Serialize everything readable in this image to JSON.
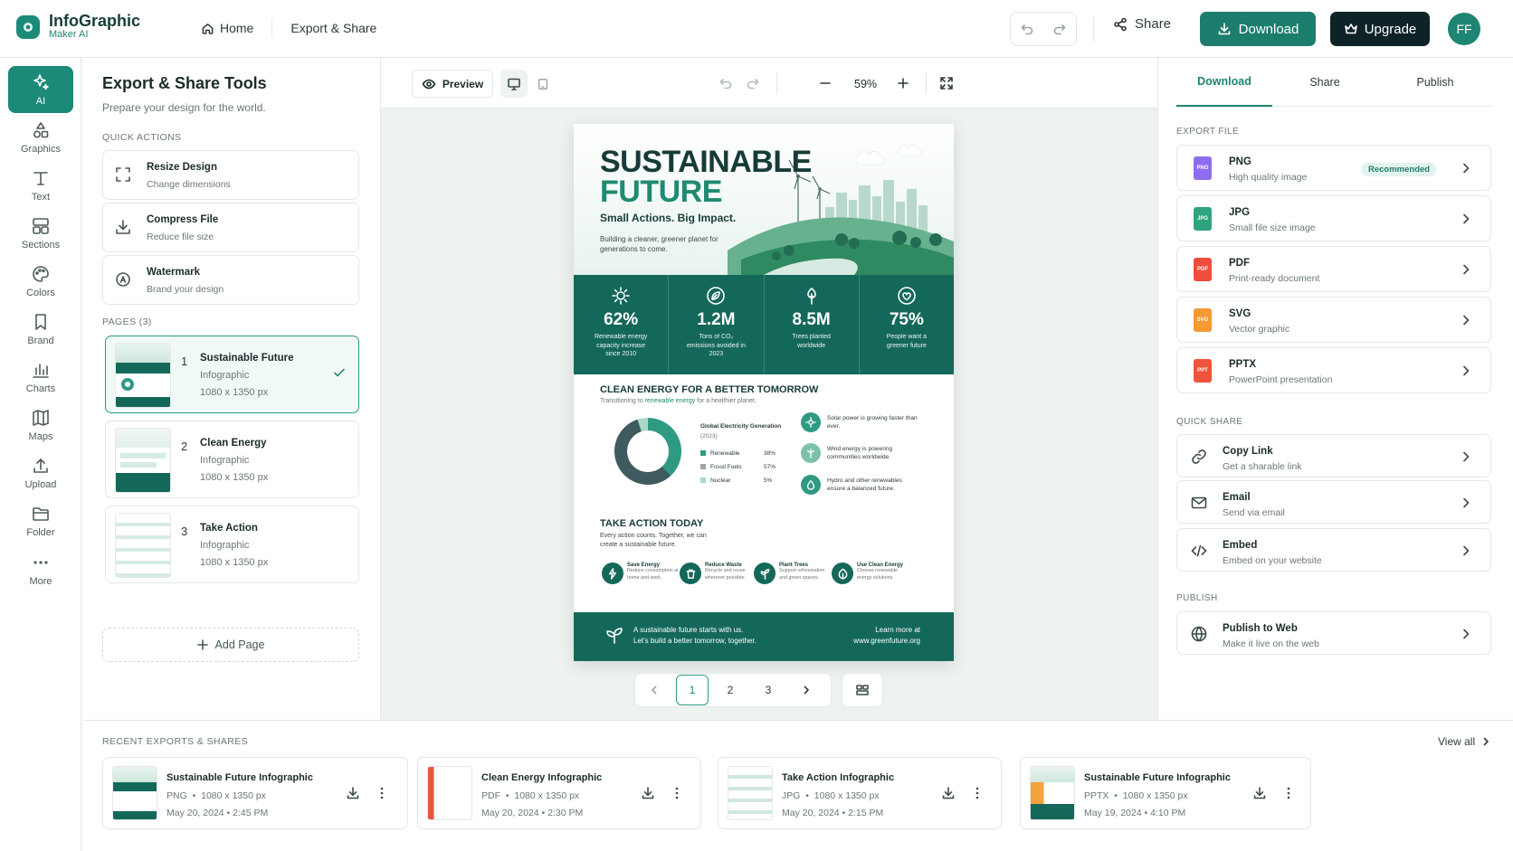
{
  "app": {
    "name": "InfoGraphic",
    "subtitle": "Maker AI",
    "avatar": "FF"
  },
  "nav": {
    "home": "Home",
    "current": "Export & Share"
  },
  "topbar": {
    "share": "Share",
    "download": "Download",
    "upgrade": "Upgrade"
  },
  "rail": [
    {
      "label": "AI",
      "icon": "sparkle-icon",
      "active": true
    },
    {
      "label": "Graphics",
      "icon": "shapes-icon"
    },
    {
      "label": "Text",
      "icon": "text-icon"
    },
    {
      "label": "Sections",
      "icon": "sections-icon"
    },
    {
      "label": "Colors",
      "icon": "palette-icon"
    },
    {
      "label": "Brand",
      "icon": "bookmark-icon"
    },
    {
      "label": "Charts",
      "icon": "bar-chart-icon"
    },
    {
      "label": "Maps",
      "icon": "map-icon"
    },
    {
      "label": "Upload",
      "icon": "upload-icon"
    },
    {
      "label": "Folder",
      "icon": "folder-icon"
    },
    {
      "label": "More",
      "icon": "more-icon"
    }
  ],
  "left_panel": {
    "title": "Export & Share Tools",
    "subtitle": "Prepare your design for the world.",
    "quick_actions_label": "QUICK ACTIONS",
    "quick_actions": [
      {
        "title": "Resize Design",
        "sub": "Change dimensions",
        "icon": "resize-icon"
      },
      {
        "title": "Compress File",
        "sub": "Reduce file size",
        "icon": "compress-icon"
      },
      {
        "title": "Watermark",
        "sub": "Brand your design",
        "icon": "watermark-icon"
      }
    ],
    "pages_label": "PAGES",
    "pages_count": "(3)",
    "pages": [
      {
        "num": "1",
        "title": "Sustainable Future",
        "type": "Infographic",
        "size": "1080 x 1350 px",
        "selected": true
      },
      {
        "num": "2",
        "title": "Clean Energy",
        "type": "Infographic",
        "size": "1080 x 1350 px"
      },
      {
        "num": "3",
        "title": "Take Action",
        "type": "Infographic",
        "size": "1080 x 1350 px"
      }
    ],
    "add_page": "Add Page"
  },
  "canvas": {
    "preview": "Preview",
    "zoom": "59%",
    "pager": [
      "1",
      "2",
      "3"
    ],
    "current_page": "1"
  },
  "poster": {
    "title_1": "SUSTAINABLE",
    "title_2": "FUTURE",
    "tagline": "Small Actions. Big Impact.",
    "desc": "Building a cleaner, greener planet for generations to come.",
    "stats": [
      {
        "value": "62%",
        "label": "Renewable energy capacity increase since 2010",
        "icon": "sun-icon"
      },
      {
        "value": "1.2M",
        "label": "Tons of CO₂ emissions avoided in 2023",
        "icon": "leaf-icon"
      },
      {
        "value": "8.5M",
        "label": "Trees planted worldwide",
        "icon": "tree-icon"
      },
      {
        "value": "75%",
        "label": "People want a greener future",
        "icon": "heart-icon"
      }
    ],
    "energy_heading": "CLEAN ENERGY FOR A BETTER TOMORROW",
    "energy_sub_1": "Transitioning to",
    "energy_sub_hl": "renewable energy",
    "energy_sub_2": "for a healthier planet.",
    "chart_title": "Global Electricity Generation",
    "chart_year": "(2023)",
    "chart_data": {
      "type": "pie",
      "categories": [
        "Renewable",
        "Fossil Fuels",
        "Nuclear"
      ],
      "values": [
        38,
        57,
        5
      ],
      "labels": [
        "38%",
        "57%",
        "5%"
      ],
      "colors": [
        "#2e9a82",
        "#3f5b5f",
        "#a9d9c6"
      ]
    },
    "facts": [
      "Solar power is growing faster than ever.",
      "Wind energy is powering communities worldwide.",
      "Hydro and other renewables ensure a balanced future."
    ],
    "action_heading": "TAKE ACTION TODAY",
    "action_sub": "Every action counts. Together, we can create a sustainable future.",
    "actions": [
      {
        "title": "Save Energy",
        "desc": "Reduce consumption at home and work."
      },
      {
        "title": "Reduce Waste",
        "desc": "Recycle and reuse wherever possible."
      },
      {
        "title": "Plant Trees",
        "desc": "Support reforestation and green spaces."
      },
      {
        "title": "Use Clean Energy",
        "desc": "Choose renewable energy solutions."
      }
    ],
    "footer_line_1": "A sustainable future starts with us.",
    "footer_line_2": "Let's build a better tomorrow, together.",
    "footer_learn": "Learn more at",
    "footer_url": "www.greenfuture.org"
  },
  "right_panel": {
    "tabs": [
      "Download",
      "Share",
      "Publish"
    ],
    "export_label": "EXPORT FILE",
    "formats": [
      {
        "name": "PNG",
        "desc": "High quality image",
        "badge": "Recommended",
        "color": "#8e6cf0"
      },
      {
        "name": "JPG",
        "desc": "Small file size image",
        "color": "#2ea37f"
      },
      {
        "name": "PDF",
        "desc": "Print-ready document",
        "color": "#ef4c3b"
      },
      {
        "name": "SVG",
        "desc": "Vector graphic",
        "color": "#f39a32"
      },
      {
        "name": "PPTX",
        "desc": "PowerPoint presentation",
        "color": "#f0533b"
      }
    ],
    "quick_share_label": "QUICK SHARE",
    "quick_share": [
      {
        "title": "Copy Link",
        "desc": "Get a sharable link",
        "icon": "link-icon"
      },
      {
        "title": "Email",
        "desc": "Send via email",
        "icon": "mail-icon"
      },
      {
        "title": "Embed",
        "desc": "Embed on your website",
        "icon": "code-icon"
      }
    ],
    "publish_label": "PUBLISH",
    "publish": {
      "title": "Publish to Web",
      "desc": "Make it live on the web",
      "icon": "globe-icon"
    }
  },
  "recent": {
    "label": "RECENT EXPORTS & SHARES",
    "view_all": "View all",
    "items": [
      {
        "title": "Sustainable Future Infographic",
        "fmt": "PNG",
        "size": "1080 x 1350 px",
        "date": "May 20, 2024 • 2:45 PM"
      },
      {
        "title": "Clean Energy Infographic",
        "fmt": "PDF",
        "size": "1080 x 1350 px",
        "date": "May 20, 2024 • 2:30 PM"
      },
      {
        "title": "Take Action Infographic",
        "fmt": "JPG",
        "size": "1080 x 1350 px",
        "date": "May 20, 2024 • 2:15 PM"
      },
      {
        "title": "Sustainable Future Infographic",
        "fmt": "PPTX",
        "size": "1080 x 1350 px",
        "date": "May 19, 2024 • 4:10 PM"
      }
    ]
  }
}
